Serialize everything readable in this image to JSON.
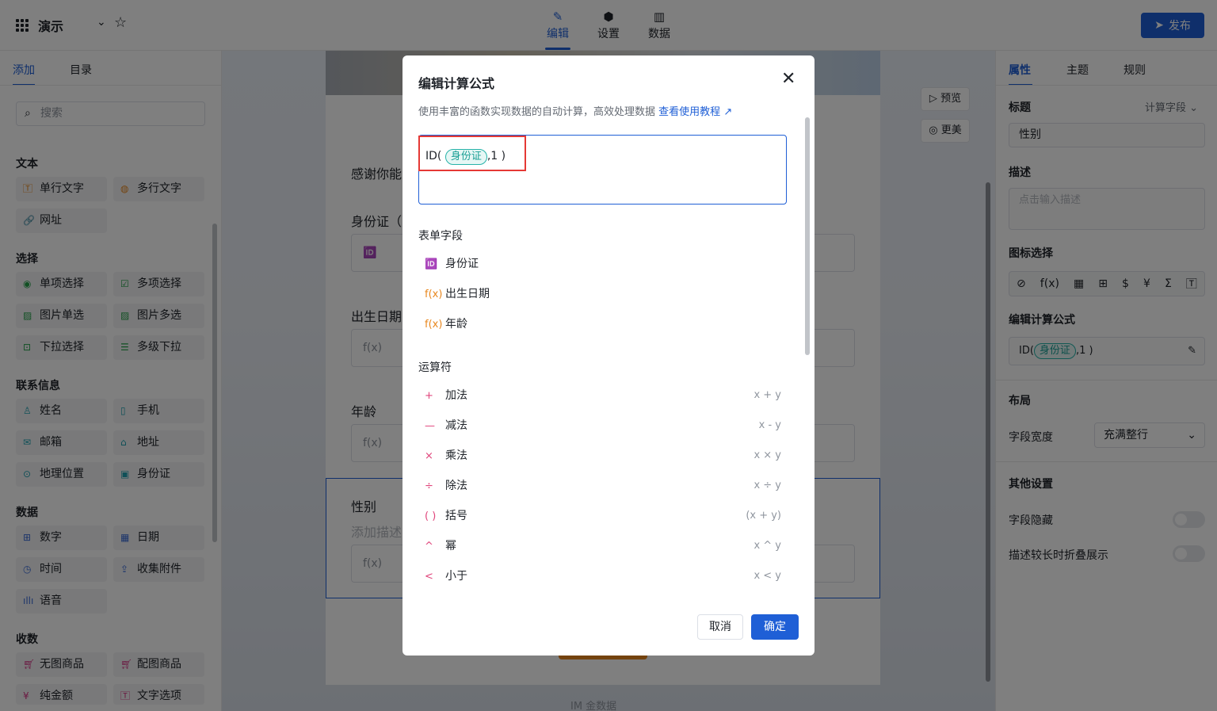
{
  "header": {
    "app_title": "演示",
    "tabs": [
      {
        "label": "编辑",
        "icon": "pencil-icon"
      },
      {
        "label": "设置",
        "icon": "hexagon-settings-icon"
      },
      {
        "label": "数据",
        "icon": "bar-chart-icon"
      }
    ],
    "publish_label": "发布"
  },
  "left_panel": {
    "tabs": [
      "添加",
      "目录"
    ],
    "search_placeholder": "搜索",
    "sections": [
      {
        "title": "文本",
        "items": [
          "单行文字",
          "多行文字",
          "网址"
        ]
      },
      {
        "title": "选择",
        "items": [
          "单项选择",
          "多项选择",
          "图片单选",
          "图片多选",
          "下拉选择",
          "多级下拉"
        ]
      },
      {
        "title": "联系信息",
        "items": [
          "姓名",
          "手机",
          "邮箱",
          "地址",
          "地理位置",
          "身份证"
        ]
      },
      {
        "title": "数据",
        "items": [
          "数字",
          "日期",
          "时间",
          "收集附件",
          "语音"
        ]
      },
      {
        "title": "收数",
        "items": [
          "无图商品",
          "配图商品",
          "纯金额",
          "文字选项"
        ]
      }
    ]
  },
  "canvas": {
    "intro_text": "感谢你能",
    "fields": [
      {
        "label": "身份证（",
        "icon": "🆔"
      },
      {
        "label": "出生日期",
        "icon": "f(x)"
      },
      {
        "label": "年龄",
        "icon": "f(x)"
      },
      {
        "label": "性别",
        "desc": "添加描述",
        "icon": "f(x)"
      }
    ],
    "preview_label": "预览",
    "beautify_label": "更美",
    "footer": "IM 金数据"
  },
  "right_panel": {
    "tabs": [
      "属性",
      "主题",
      "规则"
    ],
    "title_label": "标题",
    "field_type": "计算字段",
    "title_value": "性别",
    "desc_label": "描述",
    "desc_placeholder": "点击输入描述",
    "icon_label": "图标选择",
    "formula_label": "编辑计算公式",
    "formula_prefix": "ID(",
    "formula_tag": "身份证",
    "formula_suffix": ",1 )",
    "layout_label": "布局",
    "width_label": "字段宽度",
    "width_value": "充满整行",
    "other_label": "其他设置",
    "hide_label": "字段隐藏",
    "fold_label": "描述较长时折叠展示"
  },
  "dialog": {
    "title": "编辑计算公式",
    "description": "使用丰富的函数实现数据的自动计算，高效处理数据",
    "tutorial_link": "查看使用教程",
    "formula_prefix": "ID(",
    "formula_tag": "身份证",
    "formula_suffix": ",1 )",
    "fields_title": "表单字段",
    "fields": [
      {
        "label": "身份证",
        "icon": "🆔"
      },
      {
        "label": "出生日期",
        "icon": "f(x)"
      },
      {
        "label": "年龄",
        "icon": "f(x)"
      }
    ],
    "operators_title": "运算符",
    "operators": [
      {
        "label": "加法",
        "symbol": "+",
        "example": "x + y"
      },
      {
        "label": "减法",
        "symbol": "—",
        "example": "x - y"
      },
      {
        "label": "乘法",
        "symbol": "×",
        "example": "x × y"
      },
      {
        "label": "除法",
        "symbol": "÷",
        "example": "x ÷ y"
      },
      {
        "label": "括号",
        "symbol": "( )",
        "example": "(x + y)"
      },
      {
        "label": "幂",
        "symbol": "^",
        "example": "x ^ y"
      },
      {
        "label": "小于",
        "symbol": "<",
        "example": "x < y"
      }
    ],
    "cancel_label": "取消",
    "ok_label": "确定"
  },
  "colors": {
    "accent": "#1f5fd6",
    "highlight": "#e53935",
    "tag": "#27b3a9",
    "operator": "#e0457b",
    "formula_icon": "#e8871e"
  }
}
